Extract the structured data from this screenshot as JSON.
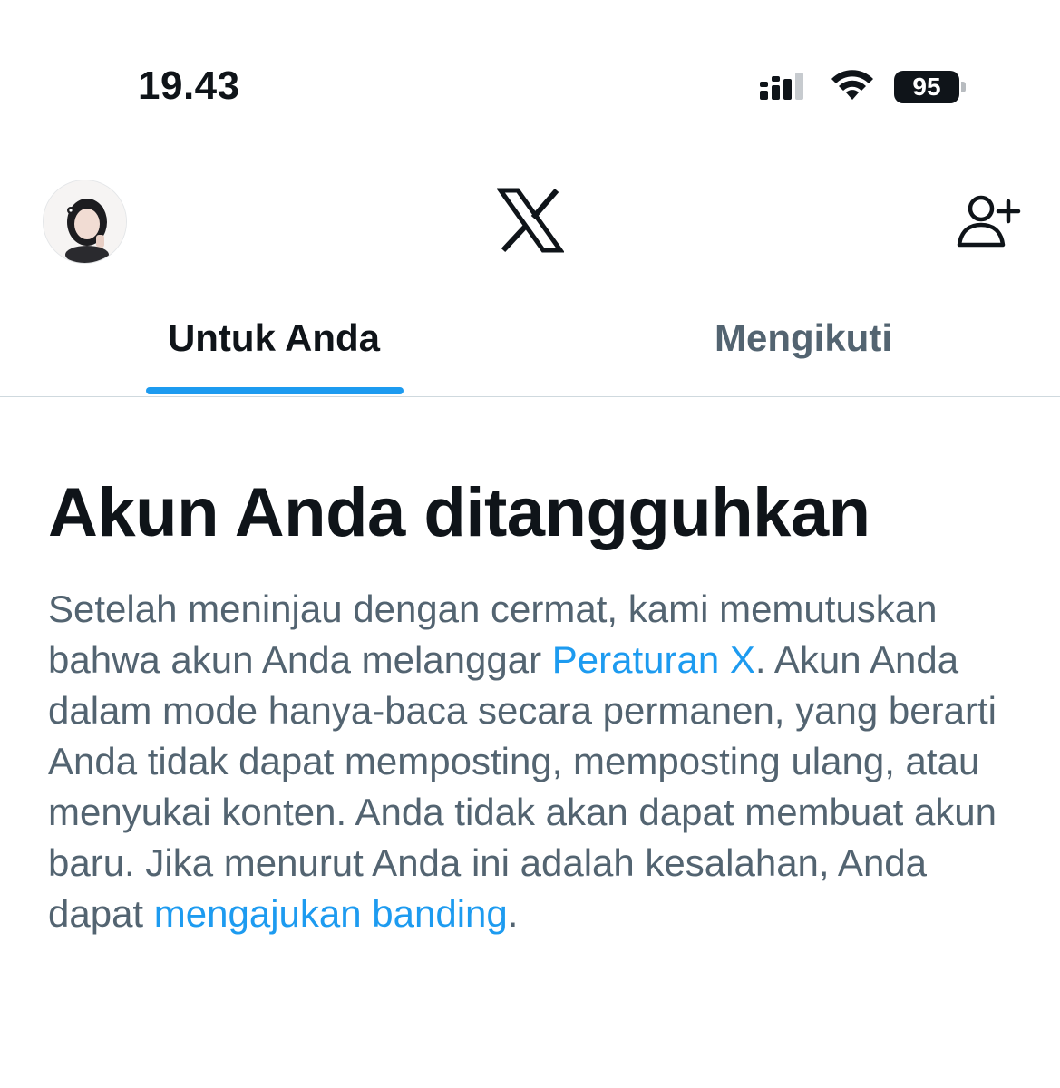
{
  "status_bar": {
    "time": "19.43",
    "battery": "95"
  },
  "nav": {
    "logo": "x-logo-icon",
    "avatar": "avatar",
    "add_user": "add-user-icon"
  },
  "tabs": [
    {
      "label": "Untuk Anda",
      "selected": true
    },
    {
      "label": "Mengikuti",
      "selected": false
    }
  ],
  "notice": {
    "title": "Akun Anda ditangguhkan",
    "text_1": "Setelah meninjau dengan cermat, kami memutuskan bahwa akun Anda melanggar ",
    "link_1": "Peraturan X",
    "text_2": ". Akun Anda dalam mode hanya-baca secara permanen, yang berarti Anda tidak dapat memposting, memposting ulang, atau menyukai konten. Anda tidak akan dapat membuat akun baru. Jika menurut Anda ini adalah kesalahan, Anda dapat ",
    "link_2": "mengajukan banding",
    "text_3": "."
  },
  "colors": {
    "accent": "#1d9bf0",
    "text_primary": "#0f1419",
    "text_secondary": "#536471"
  }
}
